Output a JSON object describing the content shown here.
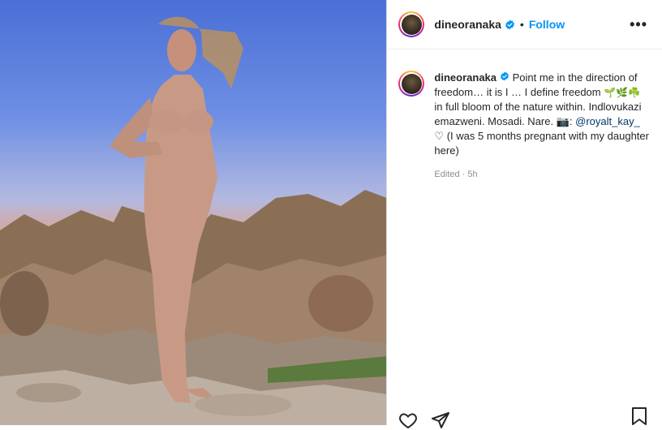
{
  "post": {
    "username": "dineoranaka",
    "follow_label": "Follow",
    "separator": "•",
    "more_label": "•••",
    "caption": {
      "part1": " Point me in the direction of freedom… it is I … I define freedom ",
      "emojis": "🌱🌿☘️",
      "part2": " in full bloom of the nature within. Indlovukazi emazweni. Mosadi. Nare. 📷: ",
      "mention": "@royalt_kay_",
      "part3": " ♡ (I was 5 months pregnant with my daughter here)"
    },
    "edited_label": "Edited · 5h"
  },
  "icons": {
    "verified": "verified-badge-icon",
    "like": "heart-icon",
    "share": "paper-plane-icon",
    "save": "bookmark-icon"
  },
  "colors": {
    "follow_blue": "#0095f6",
    "verified_blue": "#0095f6",
    "mention": "#00376b",
    "meta_gray": "#8e8e8e"
  }
}
